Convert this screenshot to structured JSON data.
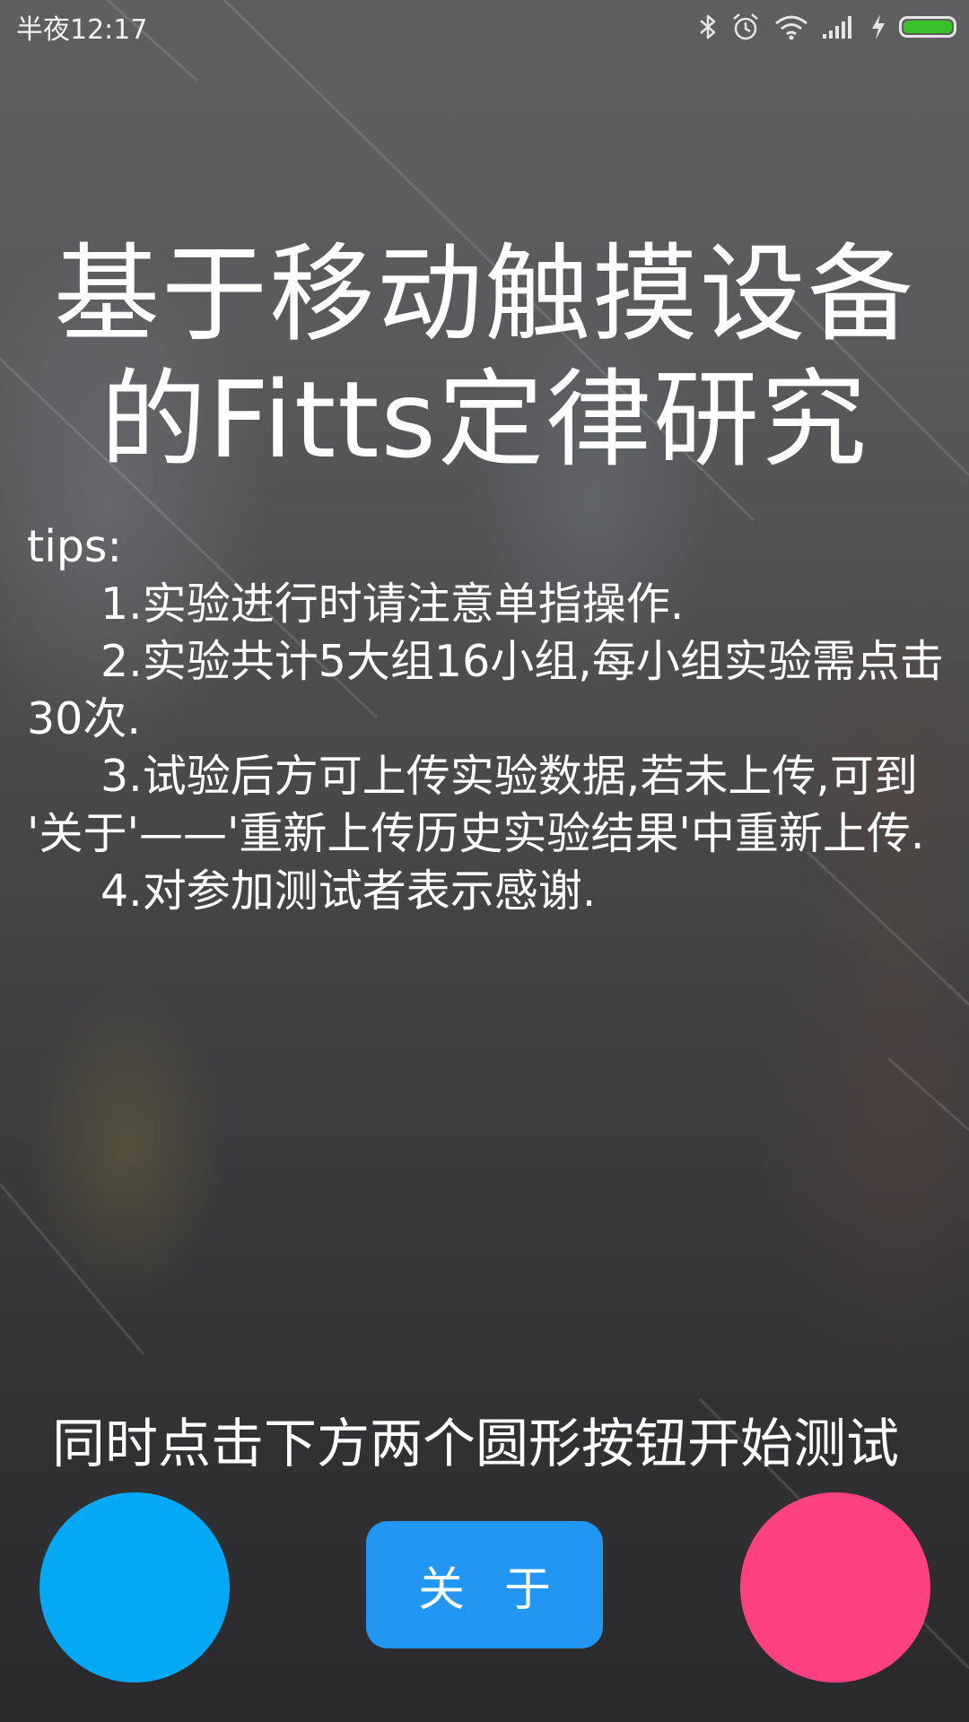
{
  "status_bar": {
    "time": "半夜12:17",
    "icons": [
      "bluetooth-icon",
      "alarm-icon",
      "wifi-icon",
      "signal-icon",
      "charging-icon",
      "battery-icon"
    ],
    "battery_level": 1.0,
    "battery_color": "#39c227"
  },
  "title": {
    "line1": "基于移动触摸设备",
    "line2": "的Fitts定律研究"
  },
  "tips": {
    "heading": "tips:",
    "items": [
      "1.实验进行时请注意单指操作.",
      "2.实验共计5大组16小组,每小组实验需点击30次.",
      "3.试验后方可上传实验数据,若未上传,可到 '关于'——'重新上传历史实验结果'中重新上传.",
      "4.对参加测试者表示感谢."
    ]
  },
  "instruction": "同时点击下方两个圆形按钮开始测试",
  "buttons": {
    "about_label": "关于",
    "left_circle_color": "#03a9f4",
    "right_circle_color": "#ff4081",
    "about_color": "#2196f3"
  }
}
